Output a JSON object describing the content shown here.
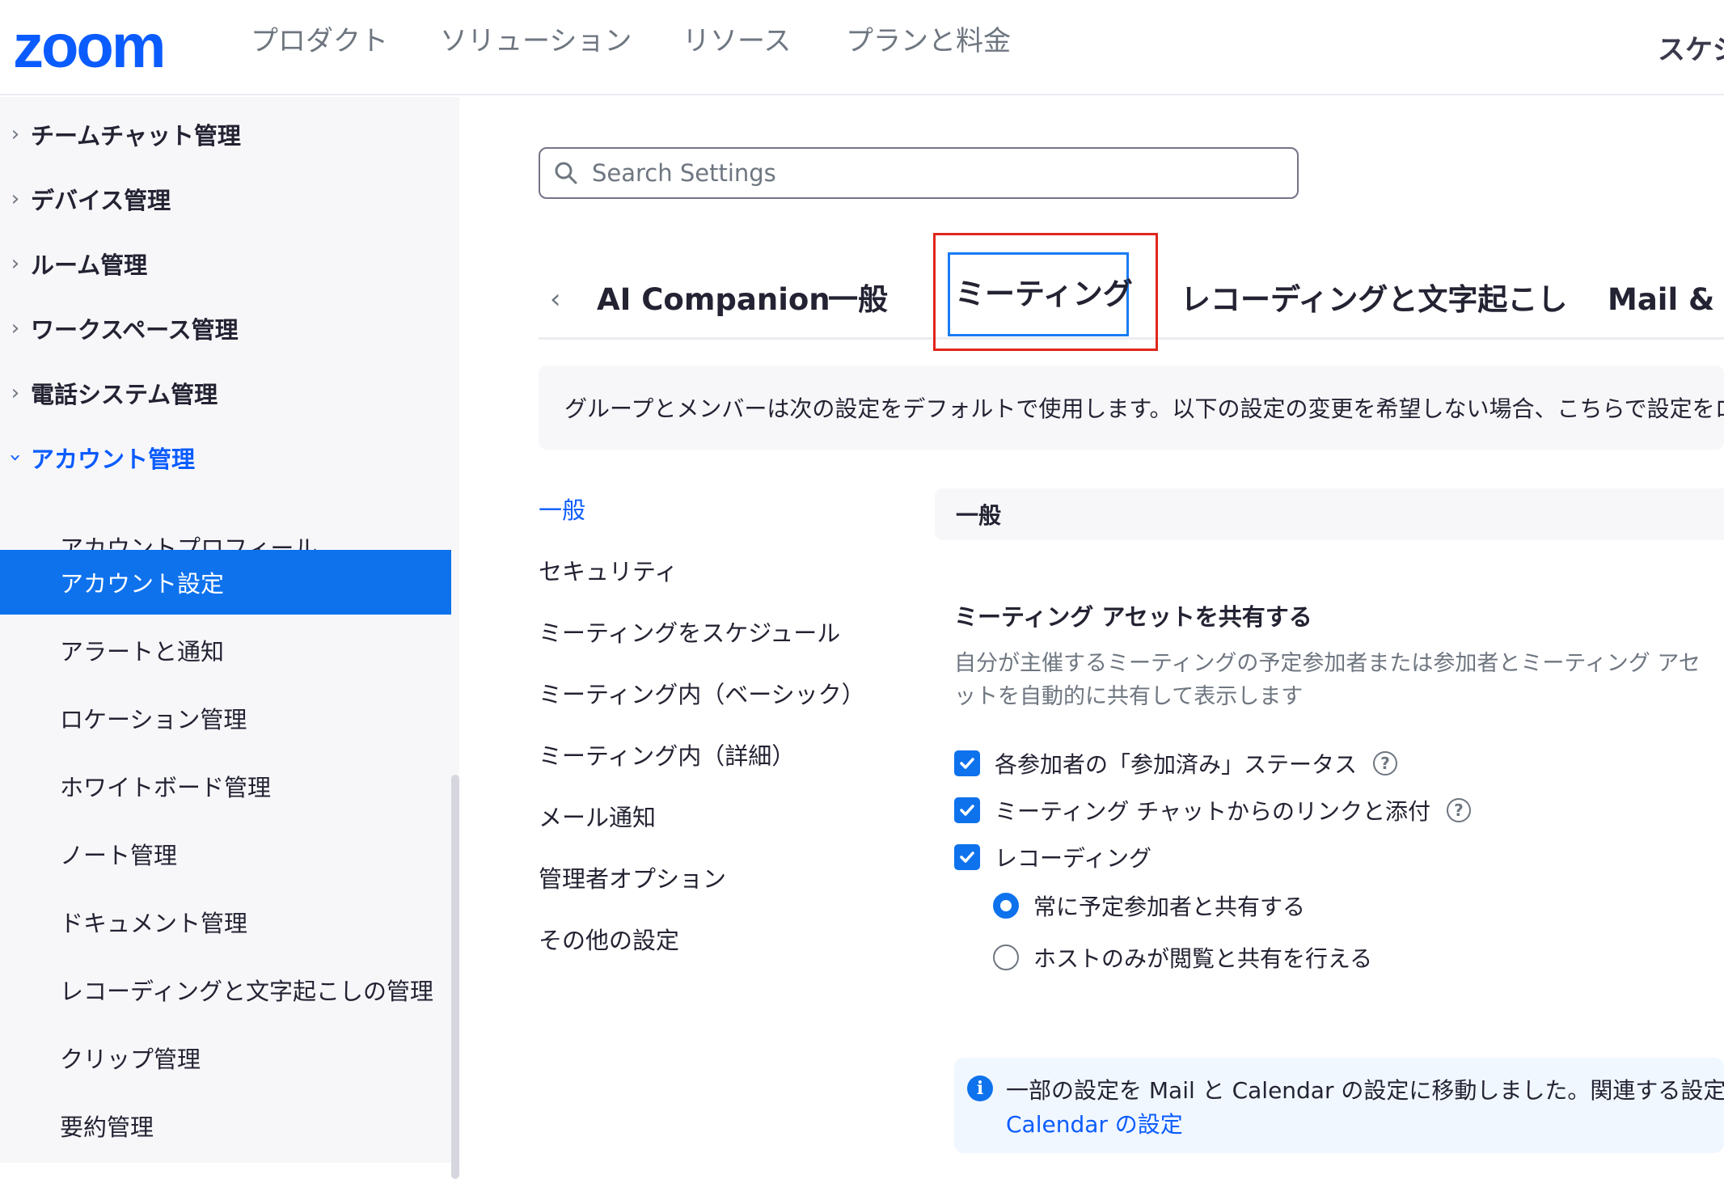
{
  "header": {
    "logo": "zoom",
    "nav": [
      "プロダクト",
      "ソリューション",
      "リソース",
      "プランと料金"
    ],
    "right_item": "スケジ"
  },
  "sidebar": {
    "groups": [
      {
        "label": "チームチャット管理",
        "expanded": false
      },
      {
        "label": "デバイス管理",
        "expanded": false
      },
      {
        "label": "ルーム管理",
        "expanded": false
      },
      {
        "label": "ワークスペース管理",
        "expanded": false
      },
      {
        "label": "電話システム管理",
        "expanded": false
      },
      {
        "label": "アカウント管理",
        "expanded": true
      }
    ],
    "sub_items": [
      {
        "label": "アカウントプロフィール",
        "active": false
      },
      {
        "label": "アカウント設定",
        "active": true
      },
      {
        "label": "アラートと通知",
        "active": false
      },
      {
        "label": "ロケーション管理",
        "active": false
      },
      {
        "label": "ホワイトボード管理",
        "active": false
      },
      {
        "label": "ノート管理",
        "active": false
      },
      {
        "label": "ドキュメント管理",
        "active": false
      },
      {
        "label": "レコーディングと文字起こしの管理",
        "active": false
      },
      {
        "label": "クリップ管理",
        "active": false
      },
      {
        "label": "要約管理",
        "active": false
      }
    ]
  },
  "search": {
    "placeholder": "Search Settings",
    "value": ""
  },
  "tabs": {
    "items": [
      {
        "label": "AI Companion"
      },
      {
        "label": "一般"
      },
      {
        "label": "ミーティング",
        "selected": true
      },
      {
        "label": "レコーディングと文字起こし"
      },
      {
        "label": "Mail & Ca"
      }
    ]
  },
  "notice": "グループとメンバーは次の設定をデフォルトで使用します。以下の設定の変更を希望しない場合、こちらで設定をロ",
  "subnav": [
    {
      "label": "一般",
      "active": true
    },
    {
      "label": "セキュリティ"
    },
    {
      "label": "ミーティングをスケジュール"
    },
    {
      "label": "ミーティング内（ベーシック）"
    },
    {
      "label": "ミーティング内（詳細）"
    },
    {
      "label": "メール通知"
    },
    {
      "label": "管理者オプション"
    },
    {
      "label": "その他の設定"
    }
  ],
  "section": {
    "title": "一般",
    "setting": {
      "title": "ミーティング アセットを共有する",
      "desc_line1": "自分が主催するミーティングの予定参加者または参加者とミーティング アセ",
      "desc_line2": "ットを自動的に共有して表示します",
      "checkboxes": [
        {
          "label": "各参加者の「参加済み」ステータス",
          "checked": true,
          "help": true
        },
        {
          "label": "ミーティング チャットからのリンクと添付",
          "checked": true,
          "help": true
        },
        {
          "label": "レコーディング",
          "checked": true,
          "help": false
        }
      ],
      "radios": [
        {
          "label": "常に予定参加者と共有する",
          "selected": true
        },
        {
          "label": "ホストのみが閲覧と共有を行える",
          "selected": false
        }
      ]
    },
    "info": {
      "text": "一部の設定を Mail と Calendar の設定に移動しました。関連する設定を",
      "link": "Calendar の設定"
    }
  },
  "colors": {
    "accent": "#0e72ed",
    "brand": "#0b5cff",
    "highlight": "#e0261b"
  }
}
